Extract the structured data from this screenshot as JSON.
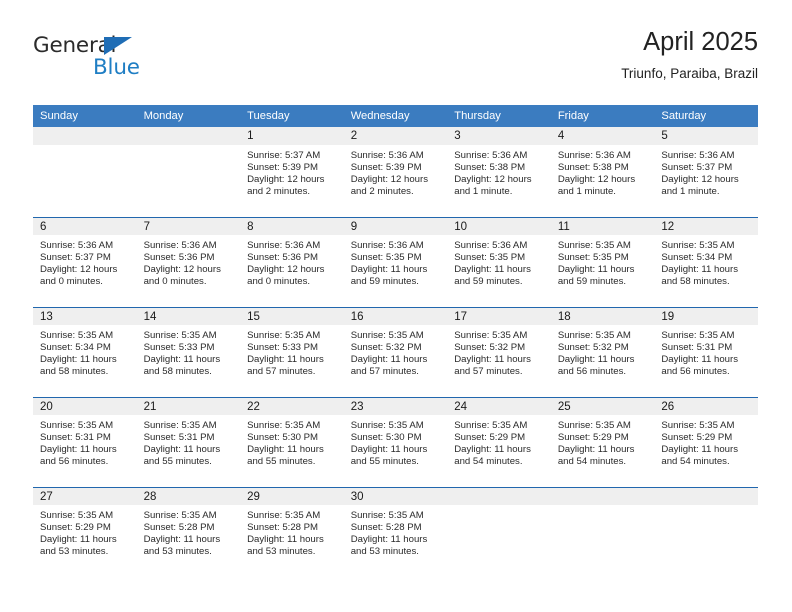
{
  "logo": {
    "text_top": "General",
    "text_bottom": "Blue",
    "triangle_icon": "triangle-icon",
    "color_dark": "#2b2b2b",
    "color_blue": "#1f7ec4"
  },
  "header": {
    "title": "April 2025",
    "subtitle": "Triunfo, Paraiba, Brazil"
  },
  "theme": {
    "header_bg": "#3b7cc0",
    "header_text": "#ffffff",
    "row_divider": "#2167ae",
    "daynum_bg": "#efefef",
    "body_text": "#2a2a2a"
  },
  "weekdays": [
    "Sunday",
    "Monday",
    "Tuesday",
    "Wednesday",
    "Thursday",
    "Friday",
    "Saturday"
  ],
  "labels": {
    "sunrise": "Sunrise:",
    "sunset": "Sunset:",
    "daylight": "Daylight:"
  },
  "weeks": [
    [
      {
        "day": "",
        "sunrise": "",
        "sunset": "",
        "daylight_line1": "",
        "daylight_line2": ""
      },
      {
        "day": "",
        "sunrise": "",
        "sunset": "",
        "daylight_line1": "",
        "daylight_line2": ""
      },
      {
        "day": "1",
        "sunrise": "Sunrise: 5:37 AM",
        "sunset": "Sunset: 5:39 PM",
        "daylight_line1": "Daylight: 12 hours",
        "daylight_line2": "and 2 minutes."
      },
      {
        "day": "2",
        "sunrise": "Sunrise: 5:36 AM",
        "sunset": "Sunset: 5:39 PM",
        "daylight_line1": "Daylight: 12 hours",
        "daylight_line2": "and 2 minutes."
      },
      {
        "day": "3",
        "sunrise": "Sunrise: 5:36 AM",
        "sunset": "Sunset: 5:38 PM",
        "daylight_line1": "Daylight: 12 hours",
        "daylight_line2": "and 1 minute."
      },
      {
        "day": "4",
        "sunrise": "Sunrise: 5:36 AM",
        "sunset": "Sunset: 5:38 PM",
        "daylight_line1": "Daylight: 12 hours",
        "daylight_line2": "and 1 minute."
      },
      {
        "day": "5",
        "sunrise": "Sunrise: 5:36 AM",
        "sunset": "Sunset: 5:37 PM",
        "daylight_line1": "Daylight: 12 hours",
        "daylight_line2": "and 1 minute."
      }
    ],
    [
      {
        "day": "6",
        "sunrise": "Sunrise: 5:36 AM",
        "sunset": "Sunset: 5:37 PM",
        "daylight_line1": "Daylight: 12 hours",
        "daylight_line2": "and 0 minutes."
      },
      {
        "day": "7",
        "sunrise": "Sunrise: 5:36 AM",
        "sunset": "Sunset: 5:36 PM",
        "daylight_line1": "Daylight: 12 hours",
        "daylight_line2": "and 0 minutes."
      },
      {
        "day": "8",
        "sunrise": "Sunrise: 5:36 AM",
        "sunset": "Sunset: 5:36 PM",
        "daylight_line1": "Daylight: 12 hours",
        "daylight_line2": "and 0 minutes."
      },
      {
        "day": "9",
        "sunrise": "Sunrise: 5:36 AM",
        "sunset": "Sunset: 5:35 PM",
        "daylight_line1": "Daylight: 11 hours",
        "daylight_line2": "and 59 minutes."
      },
      {
        "day": "10",
        "sunrise": "Sunrise: 5:36 AM",
        "sunset": "Sunset: 5:35 PM",
        "daylight_line1": "Daylight: 11 hours",
        "daylight_line2": "and 59 minutes."
      },
      {
        "day": "11",
        "sunrise": "Sunrise: 5:35 AM",
        "sunset": "Sunset: 5:35 PM",
        "daylight_line1": "Daylight: 11 hours",
        "daylight_line2": "and 59 minutes."
      },
      {
        "day": "12",
        "sunrise": "Sunrise: 5:35 AM",
        "sunset": "Sunset: 5:34 PM",
        "daylight_line1": "Daylight: 11 hours",
        "daylight_line2": "and 58 minutes."
      }
    ],
    [
      {
        "day": "13",
        "sunrise": "Sunrise: 5:35 AM",
        "sunset": "Sunset: 5:34 PM",
        "daylight_line1": "Daylight: 11 hours",
        "daylight_line2": "and 58 minutes."
      },
      {
        "day": "14",
        "sunrise": "Sunrise: 5:35 AM",
        "sunset": "Sunset: 5:33 PM",
        "daylight_line1": "Daylight: 11 hours",
        "daylight_line2": "and 58 minutes."
      },
      {
        "day": "15",
        "sunrise": "Sunrise: 5:35 AM",
        "sunset": "Sunset: 5:33 PM",
        "daylight_line1": "Daylight: 11 hours",
        "daylight_line2": "and 57 minutes."
      },
      {
        "day": "16",
        "sunrise": "Sunrise: 5:35 AM",
        "sunset": "Sunset: 5:32 PM",
        "daylight_line1": "Daylight: 11 hours",
        "daylight_line2": "and 57 minutes."
      },
      {
        "day": "17",
        "sunrise": "Sunrise: 5:35 AM",
        "sunset": "Sunset: 5:32 PM",
        "daylight_line1": "Daylight: 11 hours",
        "daylight_line2": "and 57 minutes."
      },
      {
        "day": "18",
        "sunrise": "Sunrise: 5:35 AM",
        "sunset": "Sunset: 5:32 PM",
        "daylight_line1": "Daylight: 11 hours",
        "daylight_line2": "and 56 minutes."
      },
      {
        "day": "19",
        "sunrise": "Sunrise: 5:35 AM",
        "sunset": "Sunset: 5:31 PM",
        "daylight_line1": "Daylight: 11 hours",
        "daylight_line2": "and 56 minutes."
      }
    ],
    [
      {
        "day": "20",
        "sunrise": "Sunrise: 5:35 AM",
        "sunset": "Sunset: 5:31 PM",
        "daylight_line1": "Daylight: 11 hours",
        "daylight_line2": "and 56 minutes."
      },
      {
        "day": "21",
        "sunrise": "Sunrise: 5:35 AM",
        "sunset": "Sunset: 5:31 PM",
        "daylight_line1": "Daylight: 11 hours",
        "daylight_line2": "and 55 minutes."
      },
      {
        "day": "22",
        "sunrise": "Sunrise: 5:35 AM",
        "sunset": "Sunset: 5:30 PM",
        "daylight_line1": "Daylight: 11 hours",
        "daylight_line2": "and 55 minutes."
      },
      {
        "day": "23",
        "sunrise": "Sunrise: 5:35 AM",
        "sunset": "Sunset: 5:30 PM",
        "daylight_line1": "Daylight: 11 hours",
        "daylight_line2": "and 55 minutes."
      },
      {
        "day": "24",
        "sunrise": "Sunrise: 5:35 AM",
        "sunset": "Sunset: 5:29 PM",
        "daylight_line1": "Daylight: 11 hours",
        "daylight_line2": "and 54 minutes."
      },
      {
        "day": "25",
        "sunrise": "Sunrise: 5:35 AM",
        "sunset": "Sunset: 5:29 PM",
        "daylight_line1": "Daylight: 11 hours",
        "daylight_line2": "and 54 minutes."
      },
      {
        "day": "26",
        "sunrise": "Sunrise: 5:35 AM",
        "sunset": "Sunset: 5:29 PM",
        "daylight_line1": "Daylight: 11 hours",
        "daylight_line2": "and 54 minutes."
      }
    ],
    [
      {
        "day": "27",
        "sunrise": "Sunrise: 5:35 AM",
        "sunset": "Sunset: 5:29 PM",
        "daylight_line1": "Daylight: 11 hours",
        "daylight_line2": "and 53 minutes."
      },
      {
        "day": "28",
        "sunrise": "Sunrise: 5:35 AM",
        "sunset": "Sunset: 5:28 PM",
        "daylight_line1": "Daylight: 11 hours",
        "daylight_line2": "and 53 minutes."
      },
      {
        "day": "29",
        "sunrise": "Sunrise: 5:35 AM",
        "sunset": "Sunset: 5:28 PM",
        "daylight_line1": "Daylight: 11 hours",
        "daylight_line2": "and 53 minutes."
      },
      {
        "day": "30",
        "sunrise": "Sunrise: 5:35 AM",
        "sunset": "Sunset: 5:28 PM",
        "daylight_line1": "Daylight: 11 hours",
        "daylight_line2": "and 53 minutes."
      },
      {
        "day": "",
        "sunrise": "",
        "sunset": "",
        "daylight_line1": "",
        "daylight_line2": ""
      },
      {
        "day": "",
        "sunrise": "",
        "sunset": "",
        "daylight_line1": "",
        "daylight_line2": ""
      },
      {
        "day": "",
        "sunrise": "",
        "sunset": "",
        "daylight_line1": "",
        "daylight_line2": ""
      }
    ]
  ]
}
